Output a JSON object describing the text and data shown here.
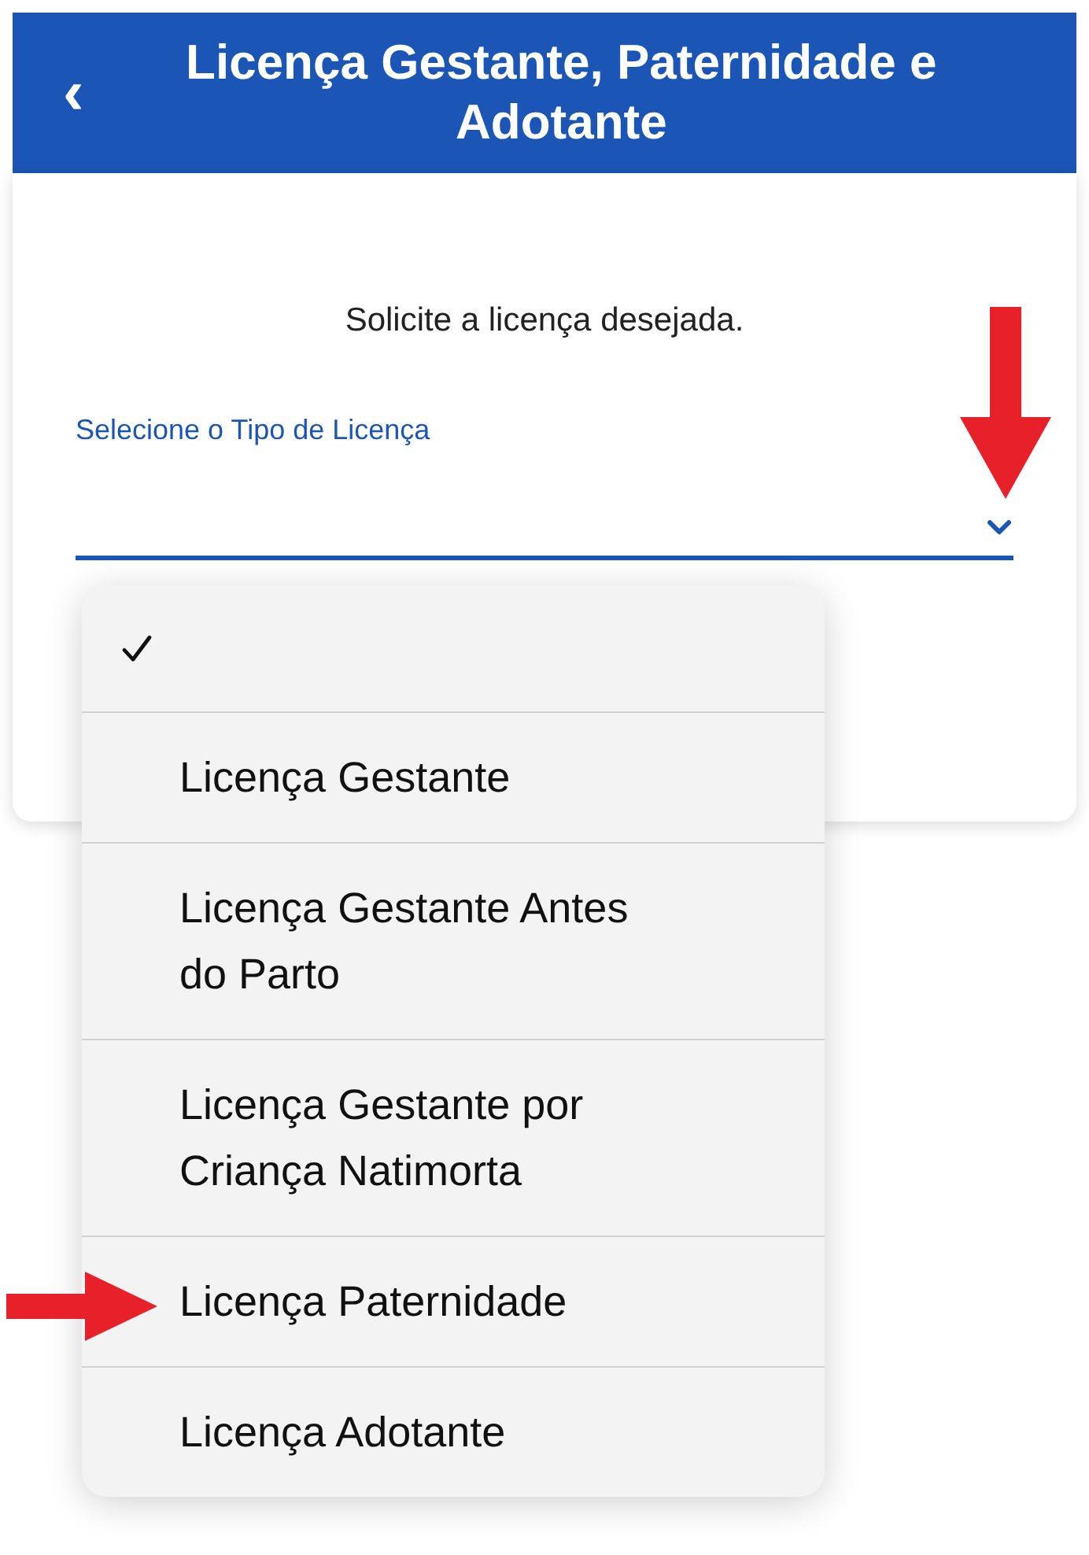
{
  "header": {
    "back": "‹",
    "title": "Licença Gestante, Paternidade e Adotante"
  },
  "card": {
    "prompt": "Solicite a licença desejada.",
    "field_label": "Selecione o Tipo de Licença"
  },
  "menu": {
    "items": [
      {
        "selected": true
      },
      {
        "label": "Licença Gestante",
        "selected": false
      },
      {
        "label": "Licença Gestante Antes do Parto",
        "selected": false
      },
      {
        "label": "Licença Gestante por Criança Natimorta",
        "selected": false
      },
      {
        "label": "Licença Paternidade",
        "selected": false
      },
      {
        "label": "Licença Adotante",
        "selected": false
      }
    ]
  }
}
